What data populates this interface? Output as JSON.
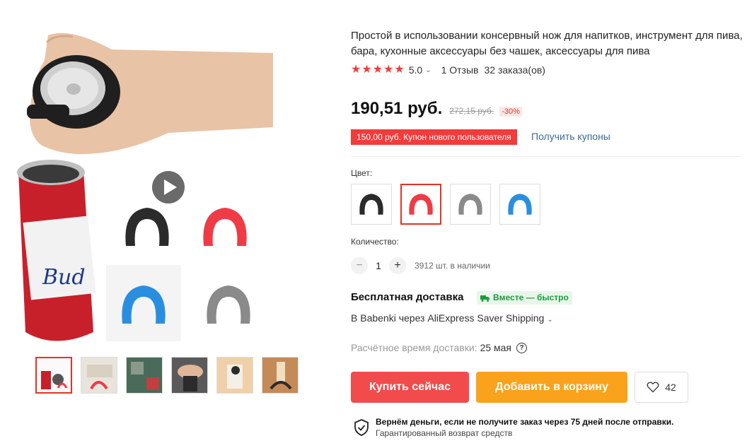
{
  "product": {
    "title": "Простой в использовании консервный нож для напитков, инструмент для пива, бара, кухонные аксессуары без чашек, аксессуары для пива",
    "rating": "5.0",
    "reviews": "1 Отзыв",
    "orders": "32 заказа(ов)",
    "stars": 5
  },
  "pricing": {
    "current": "190,51 руб.",
    "old": "272,15 руб.",
    "discount": "-30%",
    "coupon_text": "150,00 руб. Купон нового пользователя",
    "coupon_link": "Получить купоны"
  },
  "color": {
    "label": "Цвет:",
    "options": [
      {
        "name": "black",
        "hex": "#2b2b2b"
      },
      {
        "name": "red",
        "hex": "#ee3b45"
      },
      {
        "name": "gray",
        "hex": "#8a8a8a"
      },
      {
        "name": "blue",
        "hex": "#2a8ee0"
      }
    ],
    "selected_index": 1
  },
  "quantity": {
    "label": "Количество:",
    "value": "1",
    "minus": "−",
    "plus": "+",
    "stock": "3912 шт. в наличии"
  },
  "shipping": {
    "title": "Бесплатная доставка",
    "badge": "Вместе — быстро",
    "method": "В Babenki через AliExpress Saver Shipping",
    "estimate_label": "Расчётное время доставки:",
    "estimate_date": "25 мая",
    "help": "?"
  },
  "actions": {
    "buy": "Купить сейчас",
    "cart": "Добавить в корзину",
    "wish_count": "42"
  },
  "guarantee": {
    "line1": "Вернём деньги, если не получите заказ через 75 дней после отправки.",
    "line2": "Гарантированный возврат средств"
  },
  "colors": {
    "accent": "#e43225",
    "buy": "#f24b4b",
    "cart": "#fba21c",
    "link": "#3a6aa0",
    "star": "#f23b3b"
  },
  "gallery": {
    "thumbnail_count": 6,
    "active_index": 0
  }
}
